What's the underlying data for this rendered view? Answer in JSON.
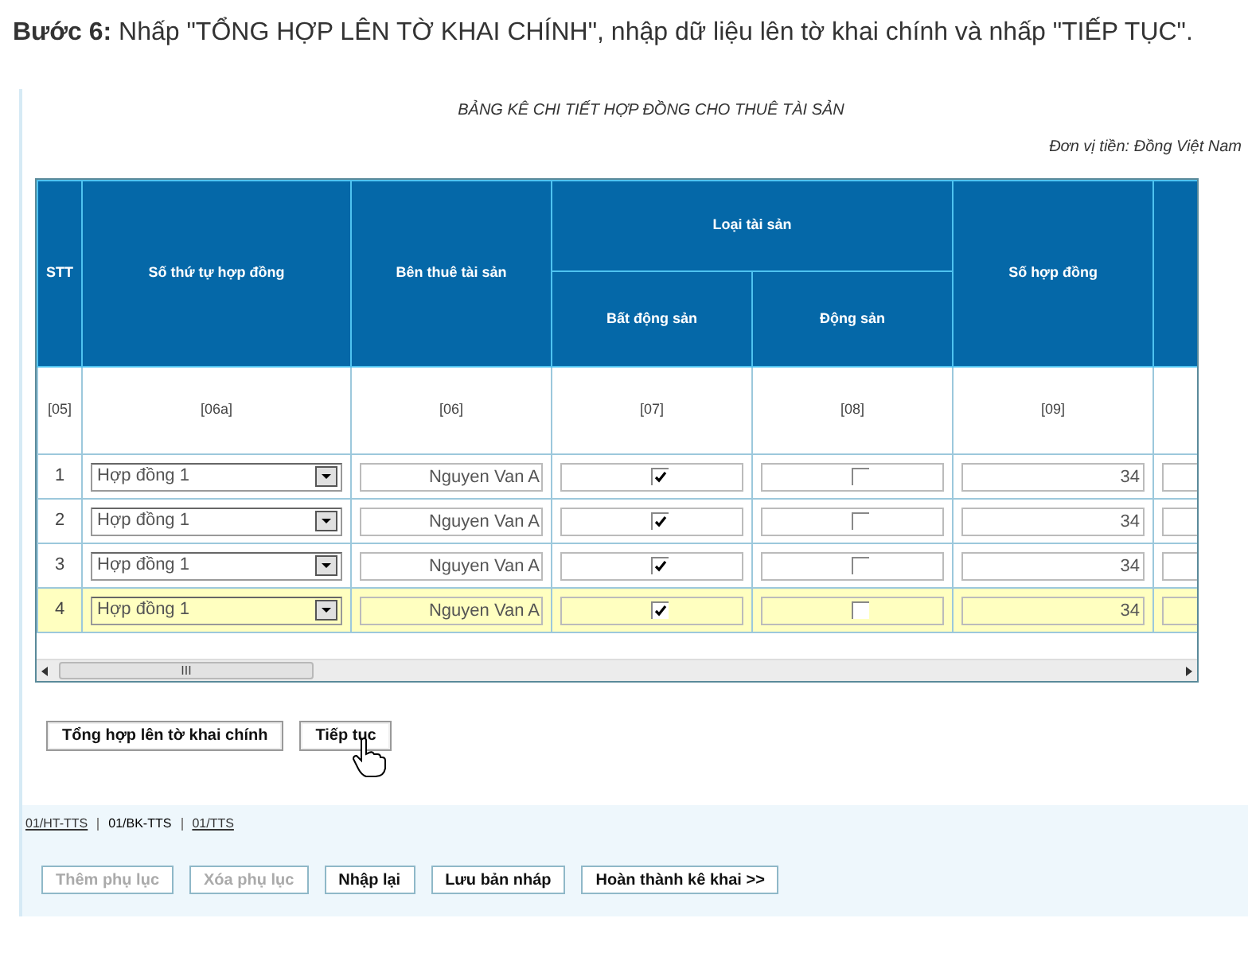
{
  "intro": {
    "text": "**Bước 6:** Nhấp \"TỔNG HỢP LÊN TỜ KHAI CHÍNH\", nhập dữ liệu lên tờ khai chính và nhấp \"TIẾP TỤC\"."
  },
  "form": {
    "title": "BẢNG KÊ CHI TIẾT HỢP ĐỒNG CHO THUÊ TÀI SẢN",
    "currency": "Đơn vị tiền: Đồng Việt Nam"
  },
  "table": {
    "headers": {
      "stt": "STT",
      "contract_order": "Số thứ tự hợp đồng",
      "lessee": "Bên thuê tài sản",
      "asset_type": "Loại tài sản",
      "real_estate": "Bất động sản",
      "movable": "Động sản",
      "contract_no": "Số hợp đồng"
    },
    "codes": [
      "[05]",
      "[06a]",
      "[06]",
      "[07]",
      "[08]",
      "[09]"
    ],
    "rows": [
      {
        "stt": "1",
        "contract": "Hợp đồng 1",
        "lessee": "Nguyen Van A",
        "real_estate": true,
        "movable": false,
        "contract_no": "34",
        "selected": false
      },
      {
        "stt": "2",
        "contract": "Hợp đồng 1",
        "lessee": "Nguyen Van A",
        "real_estate": true,
        "movable": false,
        "contract_no": "34",
        "selected": false
      },
      {
        "stt": "3",
        "contract": "Hợp đồng 1",
        "lessee": "Nguyen Van A",
        "real_estate": true,
        "movable": false,
        "contract_no": "34",
        "selected": false
      },
      {
        "stt": "4",
        "contract": "Hợp đồng 1",
        "lessee": "Nguyen Van A",
        "real_estate": true,
        "movable": false,
        "contract_no": "34",
        "selected": true
      }
    ],
    "scrollbar_grip": "III"
  },
  "actions": [
    {
      "label": "Tổng hợp lên tờ khai chính"
    },
    {
      "label": "Tiếp tục"
    }
  ],
  "form_tabs": [
    {
      "label": "01/HT-TTS",
      "selected": false
    },
    {
      "label": "01/BK-TTS",
      "selected": true
    },
    {
      "label": "01/TTS",
      "selected": false
    }
  ],
  "bottom_buttons": [
    {
      "label": "Thêm phụ lục",
      "disabled": true
    },
    {
      "label": "Xóa phụ lục",
      "disabled": true
    },
    {
      "label": "Nhập lại",
      "disabled": false
    },
    {
      "label": "Lưu bản nháp",
      "disabled": false
    },
    {
      "label": "Hoàn thành kê khai >>",
      "disabled": false
    }
  ]
}
